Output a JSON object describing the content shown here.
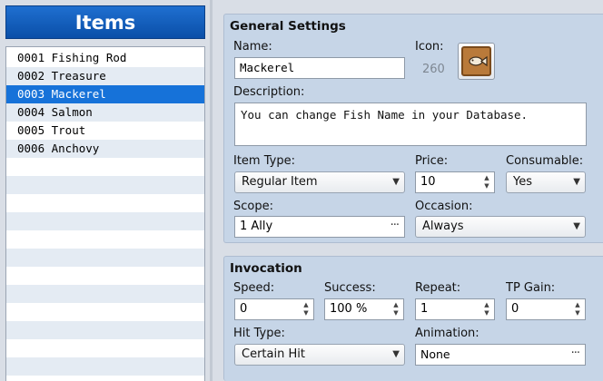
{
  "list": {
    "header": "Items",
    "items": [
      {
        "id": "0001",
        "name": "Fishing Rod"
      },
      {
        "id": "0002",
        "name": "Treasure"
      },
      {
        "id": "0003",
        "name": "Mackerel"
      },
      {
        "id": "0004",
        "name": "Salmon"
      },
      {
        "id": "0005",
        "name": "Trout"
      },
      {
        "id": "0006",
        "name": "Anchovy"
      }
    ],
    "selected_index": 2
  },
  "general": {
    "title": "General Settings",
    "name_label": "Name:",
    "name_value": "Mackerel",
    "icon_label": "Icon:",
    "icon_index": "260",
    "icon_name": "fish-icon",
    "description_label": "Description:",
    "description_value": "You can change Fish Name in your Database.",
    "item_type_label": "Item Type:",
    "item_type_value": "Regular Item",
    "price_label": "Price:",
    "price_value": "10",
    "consumable_label": "Consumable:",
    "consumable_value": "Yes",
    "scope_label": "Scope:",
    "scope_value": "1 Ally",
    "occasion_label": "Occasion:",
    "occasion_value": "Always"
  },
  "invocation": {
    "title": "Invocation",
    "speed_label": "Speed:",
    "speed_value": "0",
    "success_label": "Success:",
    "success_value": "100 %",
    "repeat_label": "Repeat:",
    "repeat_value": "1",
    "tp_gain_label": "TP Gain:",
    "tp_gain_value": "0",
    "hit_type_label": "Hit Type:",
    "hit_type_value": "Certain Hit",
    "animation_label": "Animation:",
    "animation_value": "None"
  },
  "colors": {
    "header_blue": "#0a4fa8",
    "selection_blue": "#1672d9",
    "panel_bg": "#c6d5e7"
  }
}
